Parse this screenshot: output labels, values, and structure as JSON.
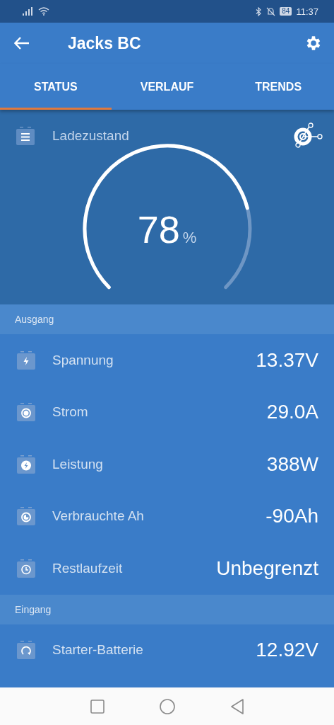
{
  "status_bar": {
    "battery": "84",
    "time": "11:37"
  },
  "app_bar": {
    "title": "Jacks BC"
  },
  "tabs": [
    {
      "label": "STATUS",
      "selected": true
    },
    {
      "label": "VERLAUF",
      "selected": false
    },
    {
      "label": "TRENDS",
      "selected": false
    }
  ],
  "gauge": {
    "label": "Ladezustand",
    "value": "78",
    "unit": "%"
  },
  "sections": [
    {
      "title": "Ausgang",
      "rows": [
        {
          "kind": "bolt",
          "label": "Spannung",
          "value": "13.37V"
        },
        {
          "kind": "dot",
          "label": "Strom",
          "value": "29.0A"
        },
        {
          "kind": "power",
          "label": "Leistung",
          "value": "388W"
        },
        {
          "kind": "pie",
          "label": "Verbrauchte Ah",
          "value": "-90Ah"
        },
        {
          "kind": "clock",
          "label": "Restlaufzeit",
          "value": "Unbegrenzt"
        }
      ]
    },
    {
      "title": "Eingang",
      "rows": [
        {
          "kind": "cycle",
          "label": "Starter-Batterie",
          "value": "12.92V"
        }
      ]
    }
  ]
}
